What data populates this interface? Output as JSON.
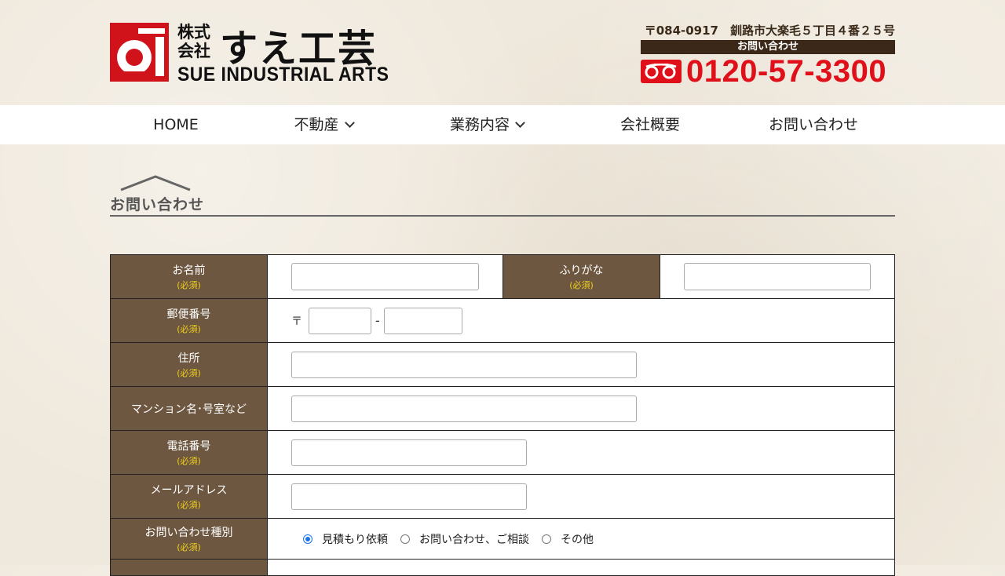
{
  "header": {
    "company_prefix": "株式会社",
    "company_name": "すえ工芸",
    "company_en": "SUE INDUSTRIAL ARTS",
    "address": "〒084-0917　釧路市大楽毛５丁目４番２５号",
    "contact_label": "お問い合わせ",
    "phone": "0120-57-3300",
    "brand_color": "#e0101a"
  },
  "nav": {
    "items": [
      {
        "label": "HOME"
      },
      {
        "label": "不動産"
      },
      {
        "label": "業務内容"
      },
      {
        "label": "会社概要"
      },
      {
        "label": "お問い合わせ"
      }
    ]
  },
  "section": {
    "title": "お問い合わせ"
  },
  "form": {
    "required_mark": "(必須)",
    "fields": {
      "name": "お名前",
      "furigana": "ふりがな",
      "zip": "郵便番号",
      "zip_mark": "〒",
      "zip_sep": "-",
      "address": "住所",
      "building": "マンション名･号室など",
      "phone": "電話番号",
      "email": "メールアドレス",
      "inquiry_type": "お問い合わせ種別"
    },
    "inquiry_options": [
      "見積もり依頼",
      "お問い合わせ、ご相談",
      "その他"
    ],
    "inquiry_selected": "見積もり依頼"
  }
}
